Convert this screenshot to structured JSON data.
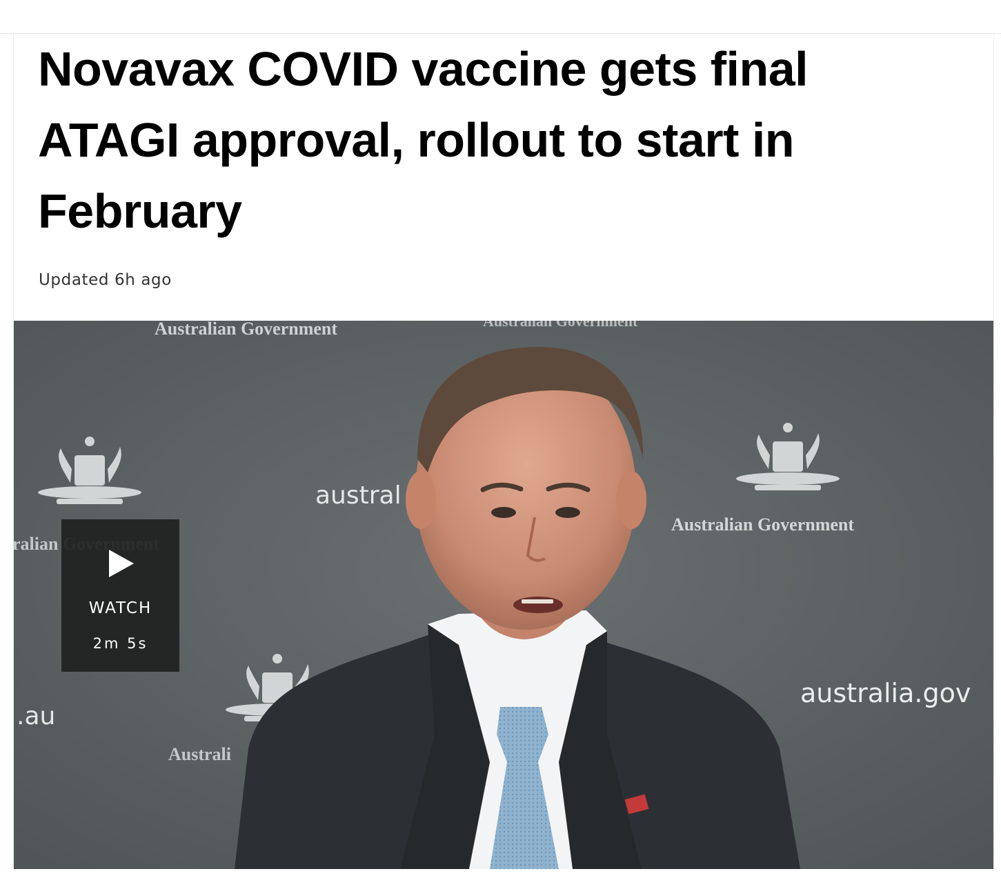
{
  "article": {
    "headline": "Novavax COVID vaccine gets final ATAGI approval, rollout to start in February",
    "updated": "Updated 6h ago"
  },
  "video": {
    "watch_label": "WATCH",
    "duration": "2m 5s",
    "backdrop_text": {
      "gov_top_left": "Australian Government",
      "gov_top_right": "Australian Government",
      "gov_left": "ralian Government",
      "gov_right": "Australian Government",
      "gov_bottom": "Australi",
      "web_center": "austral",
      "web_left": ".au",
      "web_right": "australia.gov"
    }
  },
  "icons": {
    "play": "play-icon",
    "crest": "coat-of-arms-icon"
  },
  "colors": {
    "backdrop": "#5f6566",
    "overlay": "#202121",
    "headline": "#000000"
  }
}
